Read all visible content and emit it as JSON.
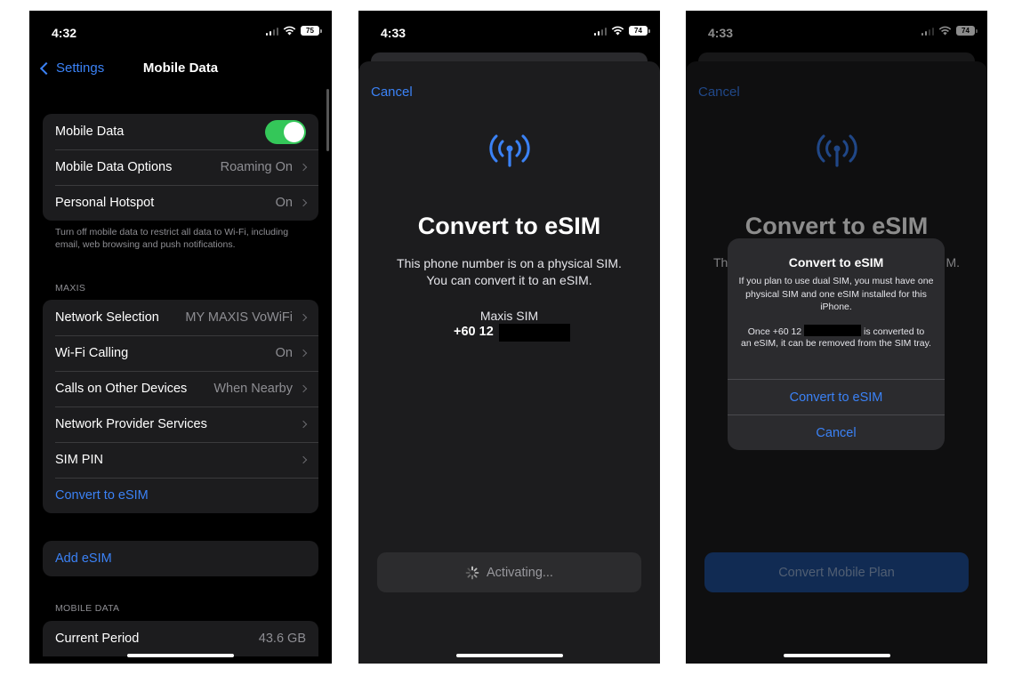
{
  "screen1": {
    "time": "4:32",
    "battery": "75",
    "back_label": "Settings",
    "title": "Mobile Data",
    "group1": [
      {
        "label": "Mobile Data",
        "value": ""
      },
      {
        "label": "Mobile Data Options",
        "value": "Roaming On"
      },
      {
        "label": "Personal Hotspot",
        "value": "On"
      }
    ],
    "footnote": "Turn off mobile data to restrict all data to Wi-Fi, including email, web browsing and push notifications.",
    "carrier_header": "MAXIS",
    "group2": [
      {
        "label": "Network Selection",
        "value": "MY MAXIS VoWiFi"
      },
      {
        "label": "Wi-Fi Calling",
        "value": "On"
      },
      {
        "label": "Calls on Other Devices",
        "value": "When Nearby"
      },
      {
        "label": "Network Provider Services",
        "value": ""
      },
      {
        "label": "SIM PIN",
        "value": ""
      },
      {
        "label": "Convert to eSIM",
        "value": ""
      }
    ],
    "add_esim": "Add eSIM",
    "data_header": "MOBILE DATA",
    "current_period": {
      "label": "Current Period",
      "value": "43.6 GB"
    }
  },
  "screen2": {
    "time": "4:33",
    "battery": "74",
    "cancel": "Cancel",
    "title": "Convert to eSIM",
    "description_line1": "This phone number is on a physical SIM.",
    "description_line2": "You can convert it to an eSIM.",
    "sim_name": "Maxis SIM",
    "sim_number": "+60 12",
    "activating": "Activating..."
  },
  "screen3": {
    "time": "4:33",
    "battery": "74",
    "cancel": "Cancel",
    "title": "Convert to eSIM",
    "behind_left": "Th",
    "behind_right": "M.",
    "alert": {
      "title": "Convert to eSIM",
      "message1": "If you plan to use dual SIM, you must have one physical SIM and one eSIM installed for this iPhone.",
      "message2_prefix": "Once +60 12",
      "message2_suffix": "is converted to",
      "message2_rest": "an eSIM, it can be removed from the SIM tray.",
      "confirm": "Convert to eSIM",
      "cancel": "Cancel"
    },
    "convert_plan": "Convert Mobile Plan"
  }
}
